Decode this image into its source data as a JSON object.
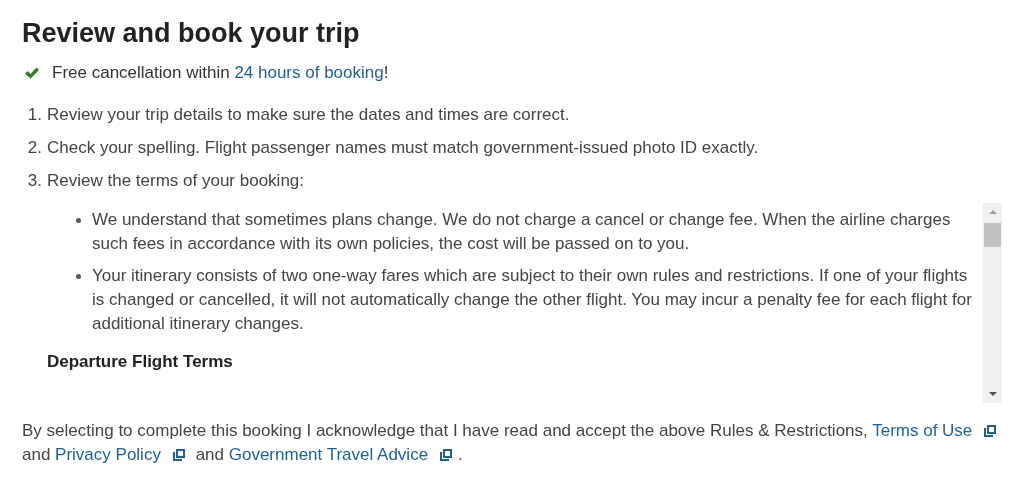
{
  "heading": "Review and book your trip",
  "notice": {
    "text": "Free cancellation within ",
    "link": "24 hours of booking",
    "suffix": "!"
  },
  "steps": [
    {
      "number": "1.",
      "text": "Review your trip details to make sure the dates and times are correct."
    },
    {
      "number": "2.",
      "text": "Check your spelling. Flight passenger names must match government-issued photo ID exactly."
    },
    {
      "number": "3.",
      "text": "Review the terms of your booking:"
    }
  ],
  "terms": {
    "bullets": [
      "We understand that sometimes plans change. We do not charge a cancel or change fee. When the airline charges such fees in accordance with its own policies, the cost will be passed on to you.",
      "Your itinerary consists of two one-way fares which are subject to their own rules and restrictions. If one of your flights is changed or cancelled, it will not automatically change the other flight. You may incur a penalty fee for each flight for additional itinerary changes."
    ],
    "section_title": "Departure Flight Terms"
  },
  "acknowledgement": [
    {
      "kind": "text",
      "text": "By selecting to complete this booking I acknowledge that I have read and accept the above Rules & Restrictions, "
    },
    {
      "kind": "link",
      "text": "Terms of Use",
      "external": true
    },
    {
      "kind": "text",
      "text": " and "
    },
    {
      "kind": "link",
      "text": "Privacy Policy",
      "external": true
    },
    {
      "kind": "text",
      "text": " and "
    },
    {
      "kind": "link",
      "text": "Government Travel Advice",
      "external": true
    },
    {
      "kind": "text",
      "text": "."
    }
  ]
}
